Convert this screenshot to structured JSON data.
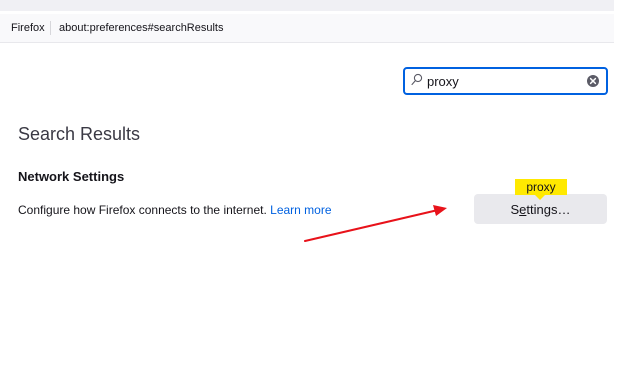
{
  "browser": {
    "identity_label": "Firefox",
    "url": "about:preferences#searchResults"
  },
  "search": {
    "value": "proxy",
    "icon": "search-icon",
    "clear_icon": "clear-icon"
  },
  "results": {
    "heading": "Search Results",
    "section_title": "Network Settings",
    "description": "Configure how Firefox connects to the internet.",
    "learn_more": "Learn more",
    "settings_button": {
      "before_accesskey": "S",
      "accesskey": "e",
      "after_accesskey": "ttings…"
    },
    "highlight_tooltip": "proxy"
  },
  "colors": {
    "accent": "#0061e0",
    "highlight": "#ffe900",
    "annotation_arrow": "#e8121a",
    "button_bg": "#e9e9ed"
  }
}
